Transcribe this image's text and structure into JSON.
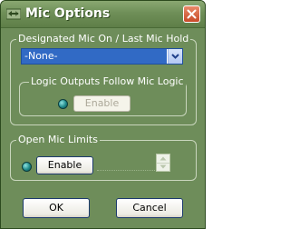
{
  "window": {
    "title": "Mic Options",
    "colors": {
      "background": "#6e8d5a",
      "title_text": "#ffffff",
      "close": "#c84a28",
      "led": "#1f8a8a",
      "selection": "#316ac5"
    }
  },
  "designated_group": {
    "legend": "Designated Mic On / Last Mic Hold",
    "dropdown_value": "-None-",
    "logic_group": {
      "legend": "Logic Outputs Follow Mic Logic",
      "enable_label": "Enable"
    }
  },
  "open_mic_group": {
    "legend": "Open Mic Limits",
    "enable_label": "Enable"
  },
  "footer": {
    "ok_label": "OK",
    "cancel_label": "Cancel"
  }
}
